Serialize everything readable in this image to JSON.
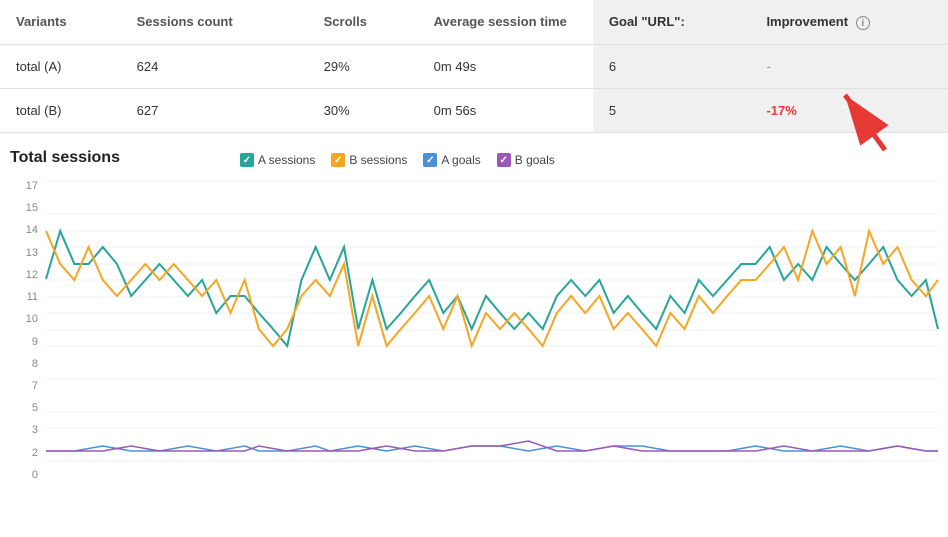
{
  "table": {
    "headers": [
      "Variants",
      "Sessions count",
      "Scrolls",
      "Average session time",
      "Goal \"URL\":",
      "Improvement"
    ],
    "rows": [
      {
        "variant": "total (A)",
        "sessions": "624",
        "scrolls": "29%",
        "avg_time": "0m 49s",
        "goal": "6",
        "improvement": "-",
        "improvement_type": "dash"
      },
      {
        "variant": "total (B)",
        "sessions": "627",
        "scrolls": "30%",
        "avg_time": "0m 56s",
        "goal": "5",
        "improvement": "-17%",
        "improvement_type": "negative"
      }
    ]
  },
  "chart": {
    "title": "Total sessions",
    "legend": [
      {
        "label": "A sessions",
        "color": "#26a69a",
        "check_color": "#26a69a"
      },
      {
        "label": "B sessions",
        "color": "#f5a623",
        "check_color": "#f5a623"
      },
      {
        "label": "A goals",
        "color": "#4a90d9",
        "check_color": "#4a90d9"
      },
      {
        "label": "B goals",
        "color": "#9b59b6",
        "check_color": "#9b59b6"
      }
    ],
    "y_labels": [
      "0",
      "2",
      "3",
      "5",
      "7",
      "8",
      "9",
      "10",
      "11",
      "12",
      "13",
      "14",
      "15",
      "17"
    ]
  },
  "colors": {
    "a_sessions": "#26a69a",
    "b_sessions": "#f5a623",
    "a_goals": "#4a90d9",
    "b_goals": "#9b59b6",
    "negative": "#e53935",
    "highlight_bg": "#f0f0f0"
  }
}
